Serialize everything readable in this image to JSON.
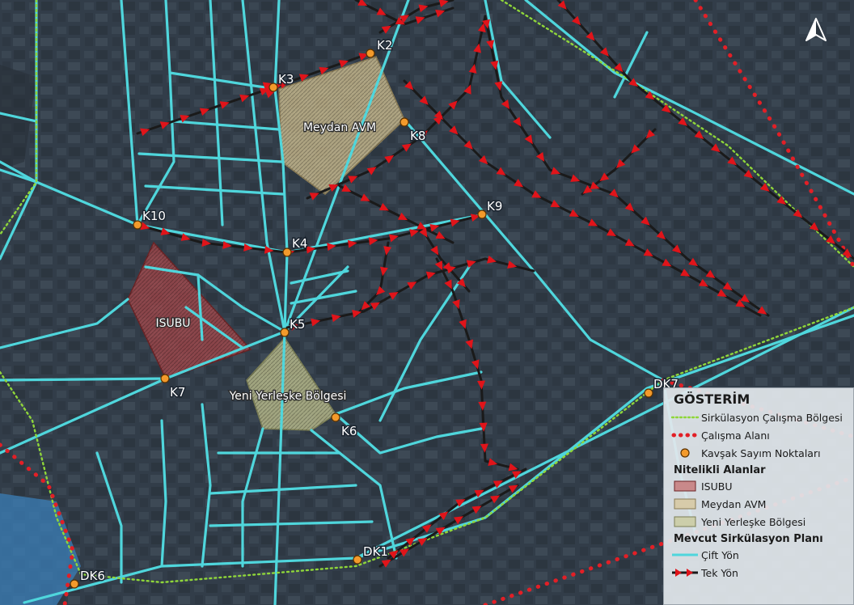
{
  "map": {
    "areas": {
      "isubu": "ISUBU",
      "meydan": "Meydan AVM",
      "yeni": "Yeni Yerleşke Bölgesi"
    },
    "points": [
      "K2",
      "K3",
      "K4",
      "K5",
      "K6",
      "K7",
      "K8",
      "K9",
      "K10",
      "DK1",
      "DK6",
      "DK7"
    ]
  },
  "legend": {
    "title": "GÖSTERİM",
    "items": [
      "Sirkülasyon Çalışma Bölgesi",
      "Çalışma Alanı",
      "Kavşak Sayım Noktaları"
    ],
    "section_areas": "Nitelikli Alanlar",
    "area_items": [
      "ISUBU",
      "Meydan AVM",
      "Yeni Yerleşke Bölgesi"
    ],
    "section_plan": "Mevcut Sirkülasyon Planı",
    "plan_items": [
      "Çift Yön",
      "Tek Yön"
    ]
  },
  "colors": {
    "two_way": "#4fd6dc",
    "one_way": "#e0141a",
    "work_zone": "#8fd63a",
    "work_area": "#e21f26",
    "count_point": "#f39a2b",
    "isubu_fill": "#a94a4c",
    "meydan_fill": "#c8b98e",
    "yeni_fill": "#b9bc8c"
  },
  "icons": [
    "north-arrow-icon"
  ]
}
